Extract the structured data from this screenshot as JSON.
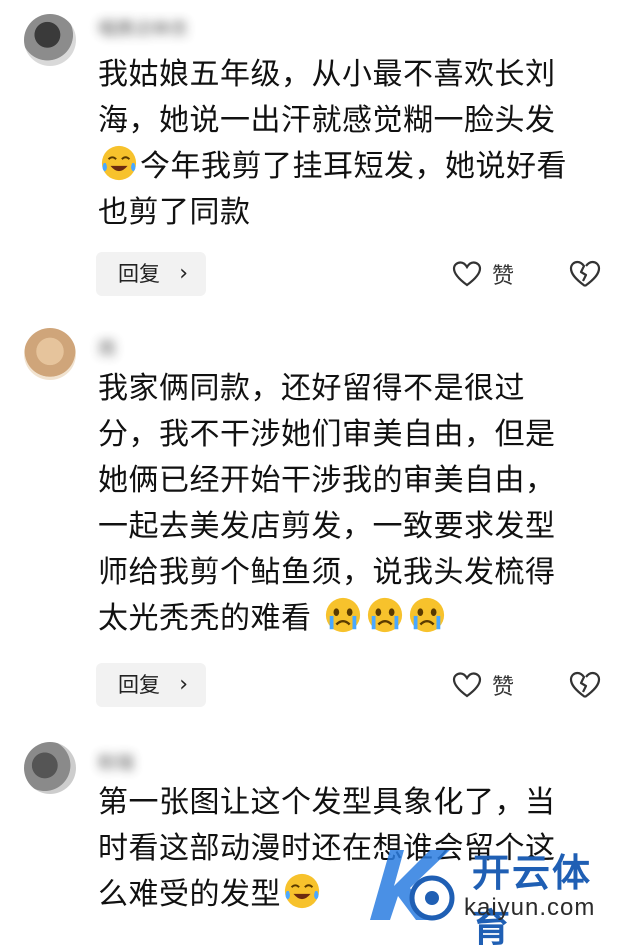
{
  "comments": [
    {
      "username": "唱携访林衣",
      "lines": [
        "我姑娘五年级，从小最不喜欢长刘",
        "海，她说一出汗就感觉糊一脸头发",
        "今年我剪了挂耳短发，她说好看",
        "也剪了同款"
      ],
      "reply_label": "回复",
      "like_label": "赞"
    },
    {
      "username": "雨",
      "lines": [
        "我家俩同款，还好留得不是很过",
        "分，我不干涉她们审美自由，但是",
        "她俩已经开始干涉我的审美自由，",
        "一起去美发店剪发，一致要求发型",
        "师给我剪个鲇鱼须，说我头发梳得",
        "太光秃秃的难看"
      ],
      "reply_label": "回复",
      "like_label": "赞"
    },
    {
      "username": "粉瑞",
      "lines": [
        "第一张图让这个发型具象化了，当",
        "时看这部动漫时还在想谁会留个这",
        "么难受的发型"
      ]
    }
  ],
  "watermark": {
    "text_cn": "开云体育",
    "text_en": "kaiyun.com"
  },
  "colors": {
    "reply_bg": "#f2f2f2",
    "watermark_blue": "#1f5fb4",
    "emoji_yellow": "#f7c22c"
  },
  "icons": [
    "crying-laughing-emoji",
    "heart-outline-icon",
    "broken-heart-icon",
    "chevron-right-icon"
  ]
}
